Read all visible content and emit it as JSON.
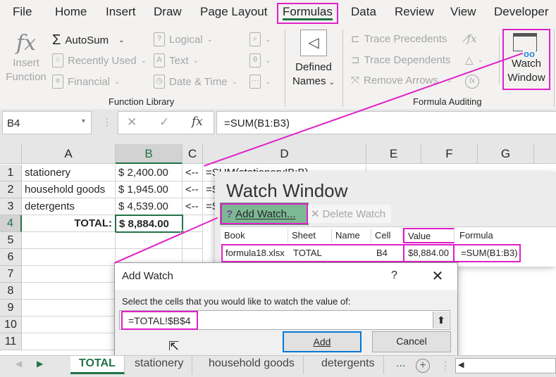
{
  "menu": {
    "items": [
      "File",
      "Home",
      "Insert",
      "Draw",
      "Page Layout",
      "Formulas",
      "Data",
      "Review",
      "View",
      "Developer"
    ],
    "active": "Formulas"
  },
  "ribbon": {
    "insert_function": {
      "line1": "Insert",
      "line2": "Function",
      "icon": "fx-icon"
    },
    "function_library": {
      "autosum": "AutoSum",
      "recently_used": "Recently Used",
      "financial": "Financial",
      "logical": "Logical",
      "text": "Text",
      "date_time": "Date & Time",
      "group_label": "Function Library"
    },
    "defined_names": {
      "line1": "Defined",
      "line2": "Names"
    },
    "formula_auditing": {
      "trace_precedents": "Trace Precedents",
      "trace_dependents": "Trace Dependents",
      "remove_arrows": "Remove Arrows",
      "group_label": "Formula Auditing"
    },
    "watch_window": {
      "line1": "Watch",
      "line2": "Window"
    }
  },
  "formula_bar": {
    "name_box": "B4",
    "cancel": "✕",
    "enter": "✓",
    "fx": "fx",
    "formula": "=SUM(B1:B3)"
  },
  "sheet": {
    "columns": [
      "A",
      "B",
      "C",
      "D",
      "E",
      "F",
      "G"
    ],
    "selected_column": "B",
    "rows": [
      "1",
      "2",
      "3",
      "4",
      "5",
      "6",
      "7",
      "8",
      "9",
      "10",
      "11"
    ],
    "selected_row": "4",
    "cells": {
      "A1": "stationery",
      "B1": "$ 2,400.00",
      "C1": "<--",
      "D1": "=SUM(stationery!B:B)",
      "A2": "household goods",
      "B2": "$ 1,945.00",
      "C2": "<--",
      "D2": "=S",
      "A3": "detergents",
      "B3": "$ 4,539.00",
      "C3": "<--",
      "D3": "=S",
      "A4": "TOTAL:",
      "B4": "$ 8,884.00"
    }
  },
  "watch_window": {
    "title": "Watch Window",
    "add_watch": "Add Watch...",
    "delete_watch": "Delete Watch",
    "headers": [
      "Book",
      "Sheet",
      "Name",
      "Cell",
      "Value",
      "Formula"
    ],
    "rows": [
      {
        "book": "formula18.xlsx",
        "sheet": "TOTAL",
        "name": "",
        "cell": "B4",
        "value": "$8,884.00",
        "formula": "=SUM(B1:B3)"
      }
    ]
  },
  "add_watch_dialog": {
    "title": "Add Watch",
    "help": "?",
    "close": "✕",
    "prompt": "Select the cells that you would like to watch the value of:",
    "reference": "=TOTAL!$B$4",
    "add_button": "Add",
    "cancel_button": "Cancel"
  },
  "sheet_tabs": {
    "tabs": [
      "TOTAL",
      "stationery",
      "household goods",
      "detergents"
    ],
    "active": "TOTAL",
    "more": "...",
    "add": "+"
  },
  "colors": {
    "accent_green": "#217346",
    "highlight_magenta": "#e020c8",
    "add_watch_bg": "#7cb894",
    "primary_button_border": "#0078d7"
  }
}
